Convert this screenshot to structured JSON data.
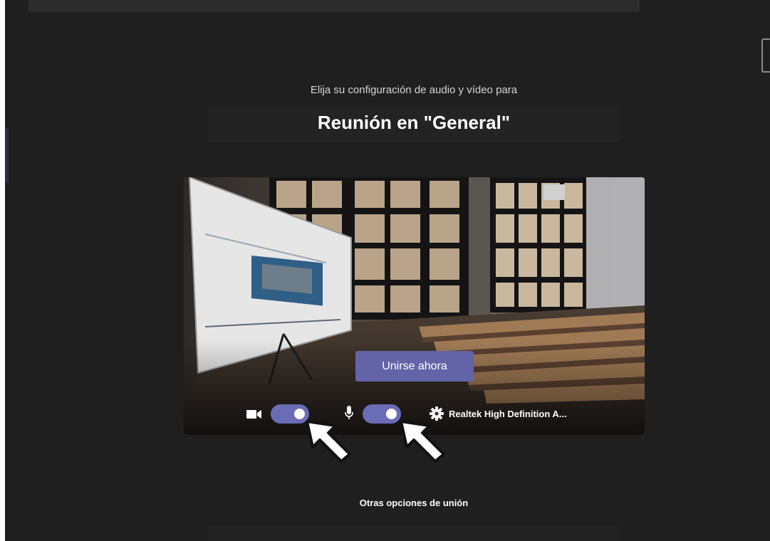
{
  "header": {
    "subtitle": "Elija su configuración de audio y vídeo para",
    "meeting_title": "Reunión en \"General\""
  },
  "preview": {
    "join_button_label": "Unirse ahora",
    "controls": {
      "camera_icon": "video-camera-icon",
      "camera_toggle_on": true,
      "mic_icon": "microphone-icon",
      "mic_toggle_on": true,
      "settings_icon": "gear-icon",
      "audio_device_label": "Realtek High Definition A..."
    }
  },
  "footer": {
    "other_options_label": "Otras opciones de unión"
  },
  "colors": {
    "background": "#1f1f1f",
    "accent": "#6264a7",
    "toggle_on": "#6a6cb5"
  }
}
